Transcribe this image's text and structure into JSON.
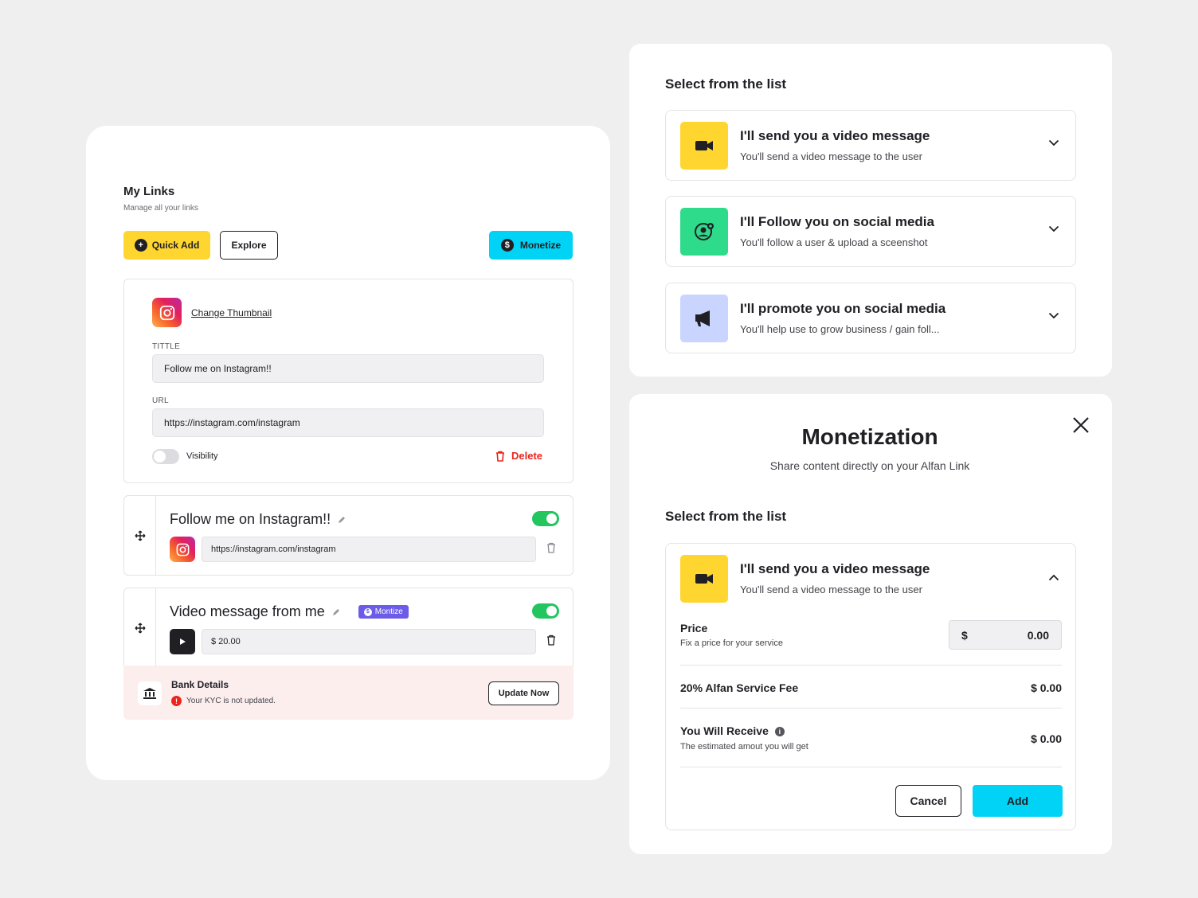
{
  "my_links": {
    "title": "My Links",
    "subtitle": "Manage all your links",
    "quick_add_label": "Quick Add",
    "explore_label": "Explore",
    "monetize_label": "Monetize",
    "editor": {
      "change_thumbnail": "Change Thumbnail",
      "title_label": "TITTLE",
      "title_value": "Follow me on Instagram!!",
      "url_label": "URL",
      "url_value": "https://instagram.com/instagram",
      "visibility_label": "Visibility",
      "visibility_on": false,
      "delete_label": "Delete"
    },
    "links": [
      {
        "title": "Follow me on Instagram!!",
        "value": "https://instagram.com/instagram",
        "enabled": true,
        "icon": "instagram-icon"
      },
      {
        "title": "Video message from me",
        "badge": "Montize",
        "value": "$ 20.00",
        "enabled": true,
        "icon": "play-icon"
      }
    ],
    "bank": {
      "title": "Bank Details",
      "warning": "Your KYC is not updated.",
      "button_label": "Update Now"
    }
  },
  "select_list": {
    "title": "Select from the list",
    "options": [
      {
        "title": "I'll send you a video message",
        "subtitle": "You'll send a video message to the user",
        "icon": "video-camera-icon",
        "color": "#ffd630"
      },
      {
        "title": "I'll Follow you on social media",
        "subtitle": "You'll follow a user & upload a sceenshot",
        "icon": "follow-user-icon",
        "color": "#2edb8a"
      },
      {
        "title": "I'll promote you on social media",
        "subtitle": "You'll help use to grow business / gain foll...",
        "icon": "megaphone-icon",
        "color": "#c9d4ff"
      }
    ]
  },
  "monetization": {
    "title": "Monetization",
    "subtitle": "Share content directly on your  Alfan Link",
    "select_title": "Select from the list",
    "selected_option": {
      "title": "I'll send you a video message",
      "subtitle": "You'll send a video message to the user"
    },
    "price_label": "Price",
    "price_sub": "Fix a price for your service",
    "currency": "$",
    "price_value": "0.00",
    "fee_label": "20% Alfan Service Fee",
    "fee_value": "$ 0.00",
    "receive_label": "You Will Receive",
    "receive_sub": "The estimated amout you will get",
    "receive_value": "$ 0.00",
    "cancel_label": "Cancel",
    "add_label": "Add"
  },
  "colors": {
    "accent_yellow": "#ffd630",
    "accent_cyan": "#00d3f5",
    "toggle_green": "#22c55e",
    "danger_red": "#e8261d",
    "badge_purple": "#6c5ce7"
  }
}
